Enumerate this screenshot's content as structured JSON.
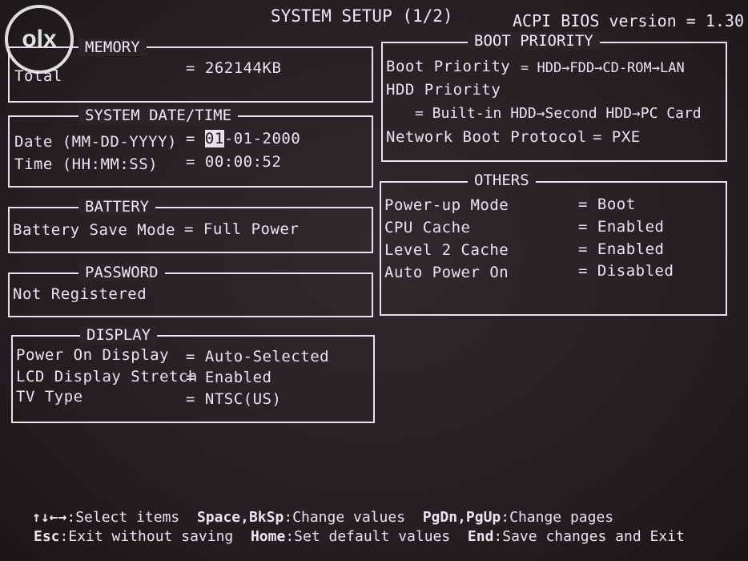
{
  "watermark": "olx",
  "header": {
    "title": "SYSTEM SETUP (1/2)",
    "bios_version": "ACPI BIOS version = 1.30"
  },
  "memory": {
    "legend": "MEMORY",
    "total_label": "Total",
    "total_value": "= 262144KB"
  },
  "datetime": {
    "legend": "SYSTEM DATE/TIME",
    "date_label": "Date (MM-DD-YYYY)",
    "date_eq": "=",
    "date_cursor": "01",
    "date_rest": "-01-2000",
    "time_label": "Time (HH:MM:SS)",
    "time_value": "= 00:00:52"
  },
  "battery": {
    "legend": "BATTERY",
    "label": "Battery Save Mode",
    "value": "= Full Power"
  },
  "password": {
    "legend": "PASSWORD",
    "status": "Not Registered"
  },
  "display": {
    "legend": "DISPLAY",
    "rows": [
      {
        "label": "Power On Display",
        "value": "= Auto-Selected"
      },
      {
        "label": "LCD Display Stretch",
        "value": "= Enabled"
      },
      {
        "label": "TV Type",
        "value": "= NTSC(US)"
      }
    ]
  },
  "boot": {
    "legend": "BOOT PRIORITY",
    "priority_label": "Boot Priority",
    "priority_value": "= HDD→FDD→CD-ROM→LAN",
    "hdd_label": "HDD Priority",
    "hdd_value": "= Built-in HDD→Second HDD→PC Card",
    "network_label": "Network Boot Protocol",
    "network_value": "= PXE"
  },
  "others": {
    "legend": "OTHERS",
    "rows": [
      {
        "label": "Power-up Mode",
        "value": "= Boot"
      },
      {
        "label": "CPU Cache",
        "value": "= Enabled"
      },
      {
        "label": "Level 2 Cache",
        "value": "= Enabled"
      },
      {
        "label": "Auto Power On",
        "value": "= Disabled"
      }
    ]
  },
  "help": {
    "line1": [
      {
        "key": "↑↓←→",
        "desc": ":Select items"
      },
      {
        "key": "Space,BkSp",
        "desc": ":Change values"
      },
      {
        "key": "PgDn,PgUp",
        "desc": ":Change pages"
      }
    ],
    "line2": [
      {
        "key": "Esc",
        "desc": ":Exit without saving"
      },
      {
        "key": "Home",
        "desc": ":Set default values"
      },
      {
        "key": "End",
        "desc": ":Save changes and Exit"
      }
    ]
  }
}
